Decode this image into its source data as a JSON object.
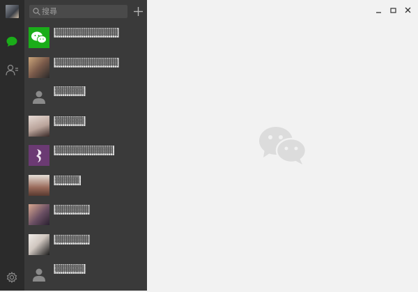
{
  "search": {
    "placeholder": "搜尋"
  },
  "chats": [
    {
      "name": "▒▒▒▒▒▒▒▒▒▒▒▒▒",
      "avatar": "wechat-logo",
      "color": "#1aad19"
    },
    {
      "name": "▒▒▒▒▒▒▒▒▒▒▒▒▒",
      "avatar": "photo",
      "color": "#7a5a4a"
    },
    {
      "name": "▒▒▒▒▒▒",
      "avatar": "default-person",
      "color": "#3a3a3a"
    },
    {
      "name": "▒▒▒▒▒▒",
      "avatar": "photo",
      "color": "#b9a39a"
    },
    {
      "name": "▒▒▒▒▒▒▒▒▒▒▒▒",
      "avatar": "photo",
      "color": "#6b3a73"
    },
    {
      "name": "▒▒▒▒▒",
      "avatar": "photo",
      "color": "#9a6a5a"
    },
    {
      "name": "▒▒▒▒▒▒▒",
      "avatar": "photo",
      "color": "#6a4f63"
    },
    {
      "name": "▒▒▒▒▒▒▒",
      "avatar": "photo",
      "color": "#d0c7c0"
    },
    {
      "name": "▒▒▒▒▒▒",
      "avatar": "default-person",
      "color": "#3a3a3a"
    }
  ],
  "colors": {
    "accent": "#1aad19",
    "rail": "#2b2b2b",
    "list": "#3a3a3a",
    "main": "#f2f2f2"
  },
  "icons": {
    "chats": "chat-bubble-icon",
    "contacts": "contacts-icon",
    "settings": "gear-icon",
    "add": "plus-icon",
    "search": "search-icon"
  }
}
